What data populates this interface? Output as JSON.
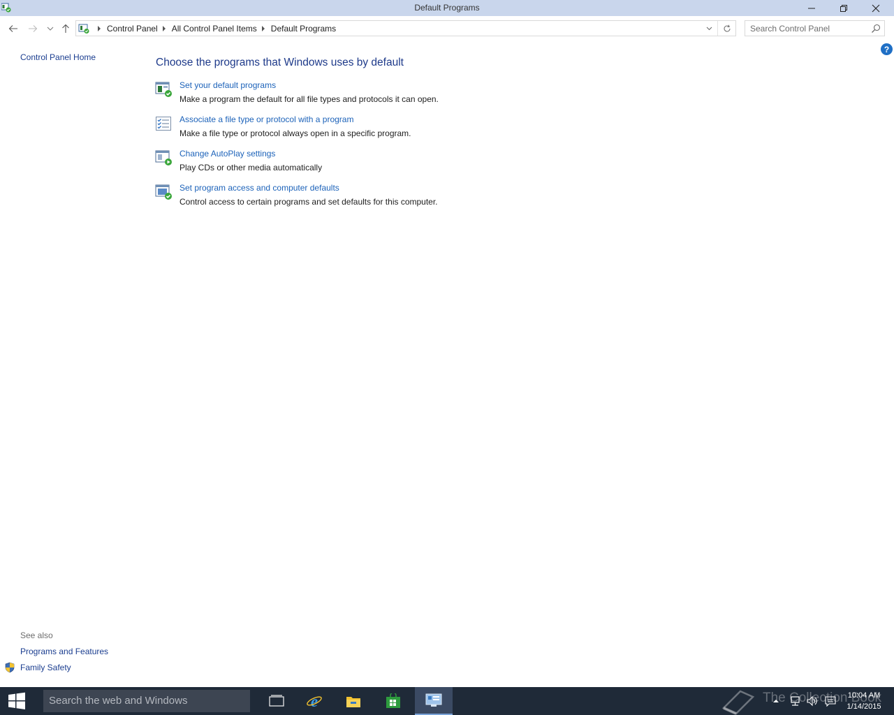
{
  "window": {
    "title": "Default Programs",
    "icon": "default-programs-icon"
  },
  "address": {
    "crumbs": [
      "Control Panel",
      "All Control Panel Items",
      "Default Programs"
    ],
    "search_placeholder": "Search Control Panel"
  },
  "help_label": "?",
  "left_pane": {
    "home_link": "Control Panel Home",
    "see_also_label": "See also",
    "see_also_links": [
      "Programs and Features",
      "Family Safety"
    ]
  },
  "main": {
    "heading": "Choose the programs that Windows uses by default",
    "tasks": [
      {
        "icon": "default-programs-icon",
        "link": "Set your default programs",
        "desc": "Make a program the default for all file types and protocols it can open."
      },
      {
        "icon": "file-association-icon",
        "link": "Associate a file type or protocol with a program",
        "desc": "Make a file type or protocol always open in a specific program."
      },
      {
        "icon": "autoplay-icon",
        "link": "Change AutoPlay settings",
        "desc": "Play CDs or other media automatically"
      },
      {
        "icon": "program-access-icon",
        "link": "Set program access and computer defaults",
        "desc": "Control access to certain programs and set defaults for this computer."
      }
    ]
  },
  "taskbar": {
    "search_placeholder": "Search the web and Windows",
    "watermark": "The Collection Book",
    "clock_time": "10:04 AM",
    "clock_date": "1/14/2015",
    "apps": [
      "task-view-icon",
      "internet-explorer-icon",
      "file-explorer-icon",
      "store-icon",
      "control-panel-icon"
    ]
  },
  "colors": {
    "titlebar": "#c9d6ec",
    "link": "#1c62b9",
    "heading": "#1e3a8a",
    "taskbar": "#1f2a38"
  }
}
